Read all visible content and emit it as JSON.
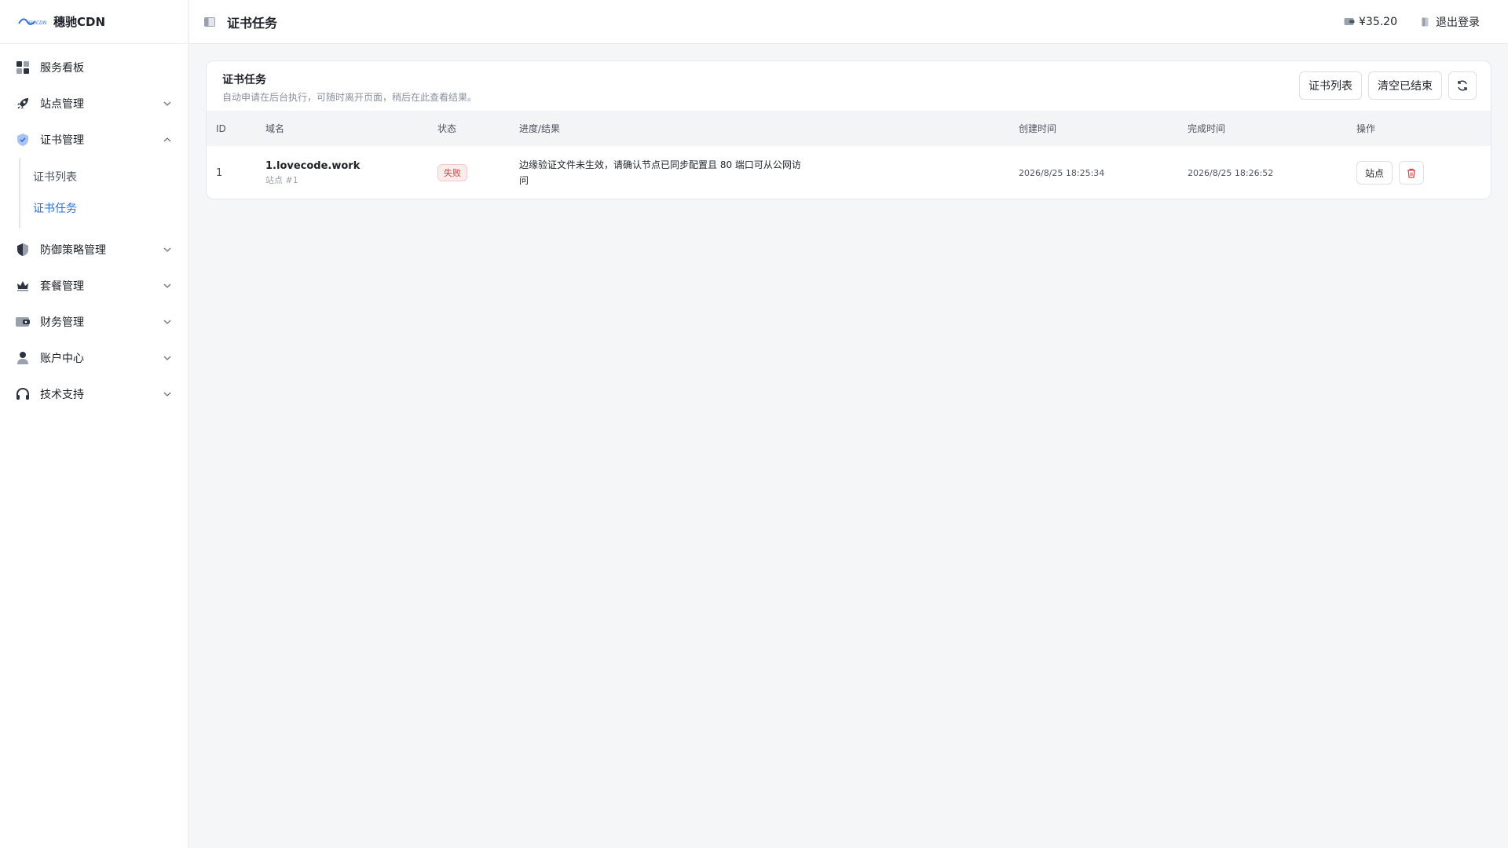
{
  "brand": {
    "name": "穗驰CDN",
    "logo_icon": "wave-logo-icon"
  },
  "sidebar": {
    "items": [
      {
        "label": "服务看板",
        "icon": "dashboard-icon"
      },
      {
        "label": "站点管理",
        "icon": "rocket-icon"
      },
      {
        "label": "证书管理",
        "icon": "shield-icon",
        "expanded": true,
        "children": [
          {
            "label": "证书列表"
          },
          {
            "label": "证书任务",
            "active": true
          }
        ]
      },
      {
        "label": "防御策略管理",
        "icon": "defense-shield-icon"
      },
      {
        "label": "套餐管理",
        "icon": "crown-icon"
      },
      {
        "label": "财务管理",
        "icon": "wallet-icon"
      },
      {
        "label": "账户中心",
        "icon": "user-icon"
      },
      {
        "label": "技术支持",
        "icon": "headset-icon"
      }
    ]
  },
  "header": {
    "title": "证书任务",
    "balance": "¥35.20",
    "logout": "退出登录"
  },
  "card": {
    "title": "证书任务",
    "subtitle": "自动申请在后台执行，可随时离开页面，稍后在此查看结果。",
    "actions": {
      "cert_list": "证书列表",
      "clear_finished": "清空已结束"
    }
  },
  "table": {
    "columns": [
      "ID",
      "域名",
      "状态",
      "进度/结果",
      "创建时间",
      "完成时间",
      "操作"
    ],
    "rows": [
      {
        "id": "1",
        "domain": "1.lovecode.work",
        "site": "站点 #1",
        "status": "失败",
        "progress": "边缘验证文件未生效，请确认节点已同步配置且 80 端口可从公网访问",
        "created": "2026/8/25 18:25:34",
        "finished": "2026/8/25 18:26:52",
        "op_site": "站点"
      }
    ]
  },
  "colors": {
    "accent": "#2e6fdb",
    "danger": "#d14343"
  }
}
